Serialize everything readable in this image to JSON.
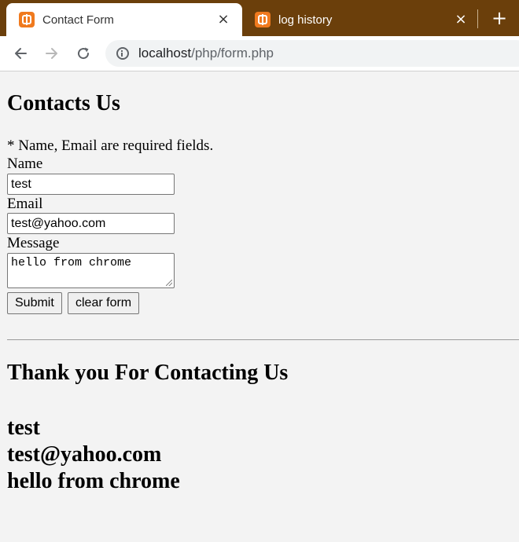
{
  "tabs": [
    {
      "title": "Contact Form",
      "active": true
    },
    {
      "title": "log history",
      "active": false
    }
  ],
  "icons": {
    "close": "×",
    "new_tab": "+"
  },
  "address_bar": {
    "host": "localhost",
    "path": "/php/form.php"
  },
  "form": {
    "title": "Contacts Us",
    "required_note": "* Name, Email are required fields.",
    "name_label": "Name",
    "name_value": "test",
    "email_label": "Email",
    "email_value": "test@yahoo.com",
    "message_label": "Message",
    "message_value": "hello from chrome",
    "submit_label": "Submit",
    "clear_label": "clear form"
  },
  "result": {
    "heading": "Thank you For Contacting Us",
    "name": "test",
    "email": "test@yahoo.com",
    "message": "hello from chrome"
  },
  "colors": {
    "tabstrip": "#6b3f0b",
    "favicon": "#f07a1e",
    "page_background": "#f3f3f3"
  }
}
